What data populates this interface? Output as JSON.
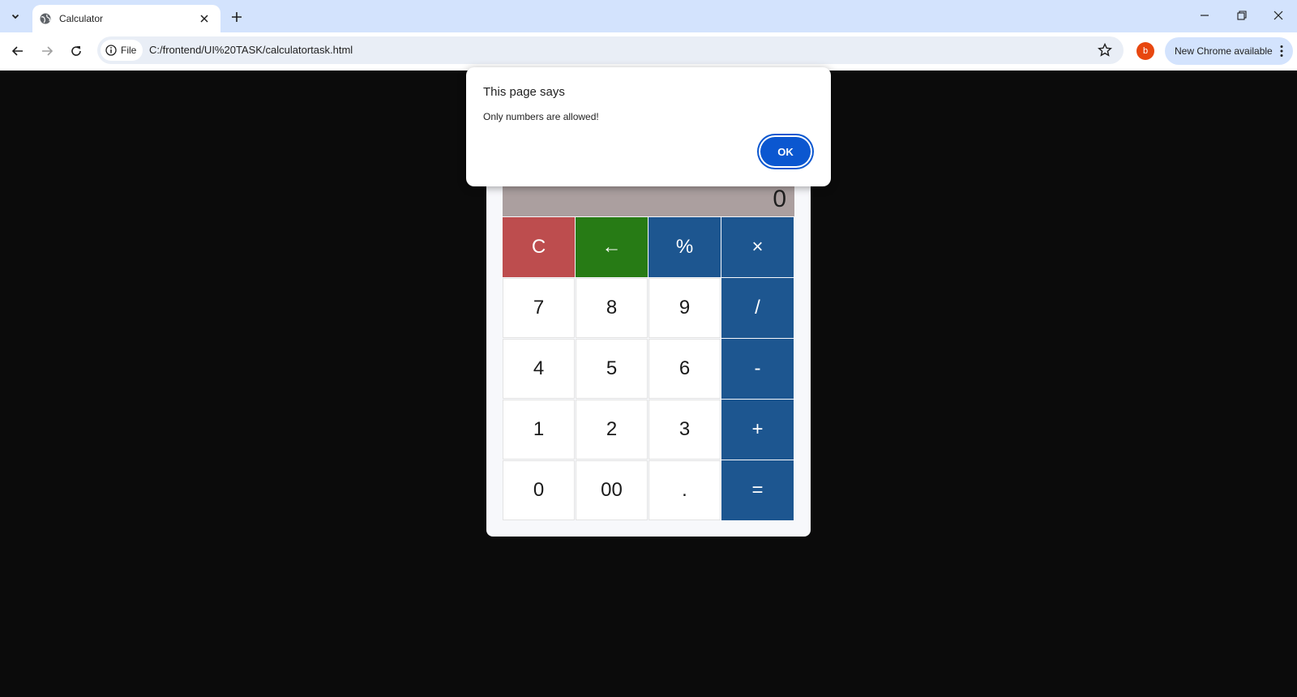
{
  "browser": {
    "tab": {
      "title": "Calculator"
    },
    "address_bar": {
      "site_chip_label": "File",
      "url": "C:/frontend/UI%20TASK/calculatortask.html"
    },
    "profile_initial": "b",
    "update_label": "New Chrome available"
  },
  "calculator": {
    "display_value": "0",
    "keys": [
      {
        "label": "C",
        "kind": "clear"
      },
      {
        "label": "←",
        "kind": "backspace"
      },
      {
        "label": "%",
        "kind": "operator"
      },
      {
        "label": "×",
        "kind": "operator"
      },
      {
        "label": "7",
        "kind": "digit"
      },
      {
        "label": "8",
        "kind": "digit"
      },
      {
        "label": "9",
        "kind": "digit"
      },
      {
        "label": "/",
        "kind": "operator"
      },
      {
        "label": "4",
        "kind": "digit"
      },
      {
        "label": "5",
        "kind": "digit"
      },
      {
        "label": "6",
        "kind": "digit"
      },
      {
        "label": "-",
        "kind": "operator"
      },
      {
        "label": "1",
        "kind": "digit"
      },
      {
        "label": "2",
        "kind": "digit"
      },
      {
        "label": "3",
        "kind": "digit"
      },
      {
        "label": "+",
        "kind": "operator"
      },
      {
        "label": "0",
        "kind": "digit"
      },
      {
        "label": "00",
        "kind": "digit"
      },
      {
        "label": ".",
        "kind": "digit"
      },
      {
        "label": "=",
        "kind": "operator"
      }
    ]
  },
  "dialog": {
    "title": "This page says",
    "message": "Only numbers are allowed!",
    "ok_label": "OK"
  },
  "colors": {
    "page_background": "#0b0b0b",
    "operator_key": "#1d5690",
    "clear_key": "#bd4d4e",
    "backspace_key": "#277b15",
    "display_background": "#ab9f9f",
    "dialog_button": "#0b57d0"
  }
}
